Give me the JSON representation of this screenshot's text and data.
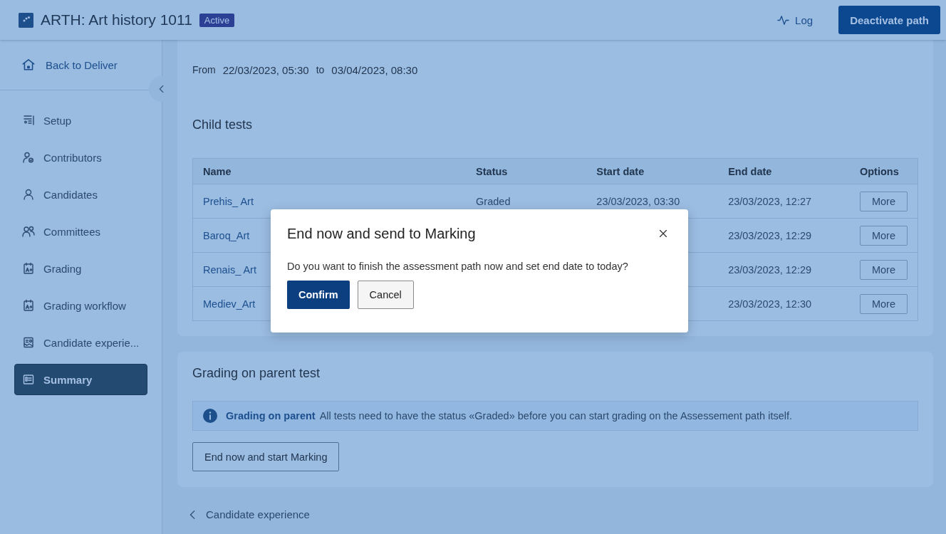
{
  "header": {
    "title": "ARTH: Art history 1011",
    "badge": "Active",
    "log_button": "Log",
    "primary_button": "Deactivate path"
  },
  "sidebar": {
    "back": "Back to Deliver",
    "items": [
      {
        "label": "Setup",
        "kind": "setup",
        "selected": false
      },
      {
        "label": "Contributors",
        "kind": "contributors",
        "selected": false
      },
      {
        "label": "Candidates",
        "kind": "candidates",
        "selected": false
      },
      {
        "label": "Committees",
        "kind": "committees",
        "selected": false
      },
      {
        "label": "Grading",
        "kind": "grading",
        "selected": false
      },
      {
        "label": "Grading workflow",
        "kind": "grading",
        "selected": false
      },
      {
        "label": "Candidate experie...",
        "kind": "experience",
        "selected": false
      },
      {
        "label": "Summary",
        "kind": "summary",
        "selected": true
      }
    ]
  },
  "period": {
    "from_label": "From",
    "from": "22/03/2023, 05:30",
    "to_label": "to",
    "to": "03/04/2023, 08:30"
  },
  "child_tests": {
    "title": "Child tests",
    "columns": [
      "Name",
      "Status",
      "Start date",
      "End date",
      "Options"
    ],
    "rows": [
      {
        "name": "Prehis_ Art",
        "status": "Graded",
        "start_date": "23/03/2023, 03:30",
        "end_date": "23/03/2023, 12:27",
        "action": "More"
      },
      {
        "name": "Baroq_Art",
        "end_date": "23/03/2023, 12:29",
        "action": "More"
      },
      {
        "name": "Renais_ Art",
        "end_date": "23/03/2023, 12:29",
        "action": "More"
      },
      {
        "name": "Mediev_Art",
        "end_date": "23/03/2023, 12:30",
        "action": "More"
      }
    ]
  },
  "grading": {
    "title": "Grading on parent test",
    "notice_title": "Grading on parent",
    "notice_text": "All tests need to have the status «Graded» before you can start grading on the Assessement path itself.",
    "button": "End now and start Marking"
  },
  "back_link": "Candidate experience",
  "dialog": {
    "title": "End now and send to Marking",
    "message": "Do you want to finish the assessment path now and set end date to today?",
    "confirm": "Confirm",
    "cancel": "Cancel"
  }
}
